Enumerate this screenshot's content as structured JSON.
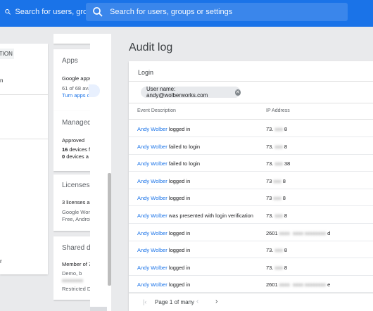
{
  "header": {
    "search_placeholder_1": "Search for users, groups or settings",
    "search_placeholder_2": "Search for users, groups or settings"
  },
  "left_panel": {
    "chip_label": "ATION",
    "text_n": "n",
    "text_r": "r"
  },
  "cards": {
    "apps": {
      "title": "Apps",
      "line1": "Google apps",
      "line2": "61 of 68 ava",
      "link": "Turn apps o"
    },
    "managed": {
      "title": "Managed",
      "line1": "Approved",
      "line2_count": "16",
      "line2_rest": " devices fr",
      "line3_count": "0",
      "line3_rest": " devices a"
    },
    "licenses": {
      "title": "Licenses",
      "line1": "3 licenses a",
      "line2": "Google Work",
      "line3": "Free, Androi"
    },
    "shared": {
      "title": "Shared dr",
      "line1": "Member of 7",
      "line2": "Demo, b",
      "line4": "Restricted D"
    }
  },
  "page_title": "Audit log",
  "audit": {
    "section_label": "Login",
    "filter_chip": "User name: andy@wolberworks.com",
    "columns": [
      "Event Description",
      "IP Address"
    ],
    "rows": [
      {
        "user": "Andy Wolber",
        "action": " logged in",
        "ip_prefix": "73.",
        "ip_suffix": "8"
      },
      {
        "user": "Andy Wolber",
        "action": " failed to login",
        "ip_prefix": "73.",
        "ip_suffix": "8"
      },
      {
        "user": "Andy Wolber",
        "action": " failed to login",
        "ip_prefix": "73.",
        "ip_suffix": "38"
      },
      {
        "user": "Andy Wolber",
        "action": " logged in",
        "ip_prefix": "73",
        "ip_suffix": "8"
      },
      {
        "user": "Andy Wolber",
        "action": " logged in",
        "ip_prefix": "73",
        "ip_suffix": "8"
      },
      {
        "user": "Andy Wolber",
        "action": " was presented with login verification",
        "ip_prefix": "73.",
        "ip_suffix": "8"
      },
      {
        "user": "Andy Wolber",
        "action": " logged in",
        "ip_prefix": "2601",
        "ip_suffix": "d"
      },
      {
        "user": "Andy Wolber",
        "action": " logged in",
        "ip_prefix": "73.",
        "ip_suffix": "8"
      },
      {
        "user": "Andy Wolber",
        "action": " logged in",
        "ip_prefix": "73.",
        "ip_suffix": "8"
      },
      {
        "user": "Andy Wolber",
        "action": " logged in",
        "ip_prefix": "2601",
        "ip_suffix": "e"
      }
    ],
    "pagination": "Page 1 of many"
  },
  "icons": {
    "search": "search-icon",
    "close": "close-icon",
    "first_page": "first-page-icon",
    "prev": "chevron-left-icon",
    "next": "chevron-right-icon"
  },
  "colors": {
    "header_bg": "#1a73e8",
    "link": "#1a73e8"
  }
}
